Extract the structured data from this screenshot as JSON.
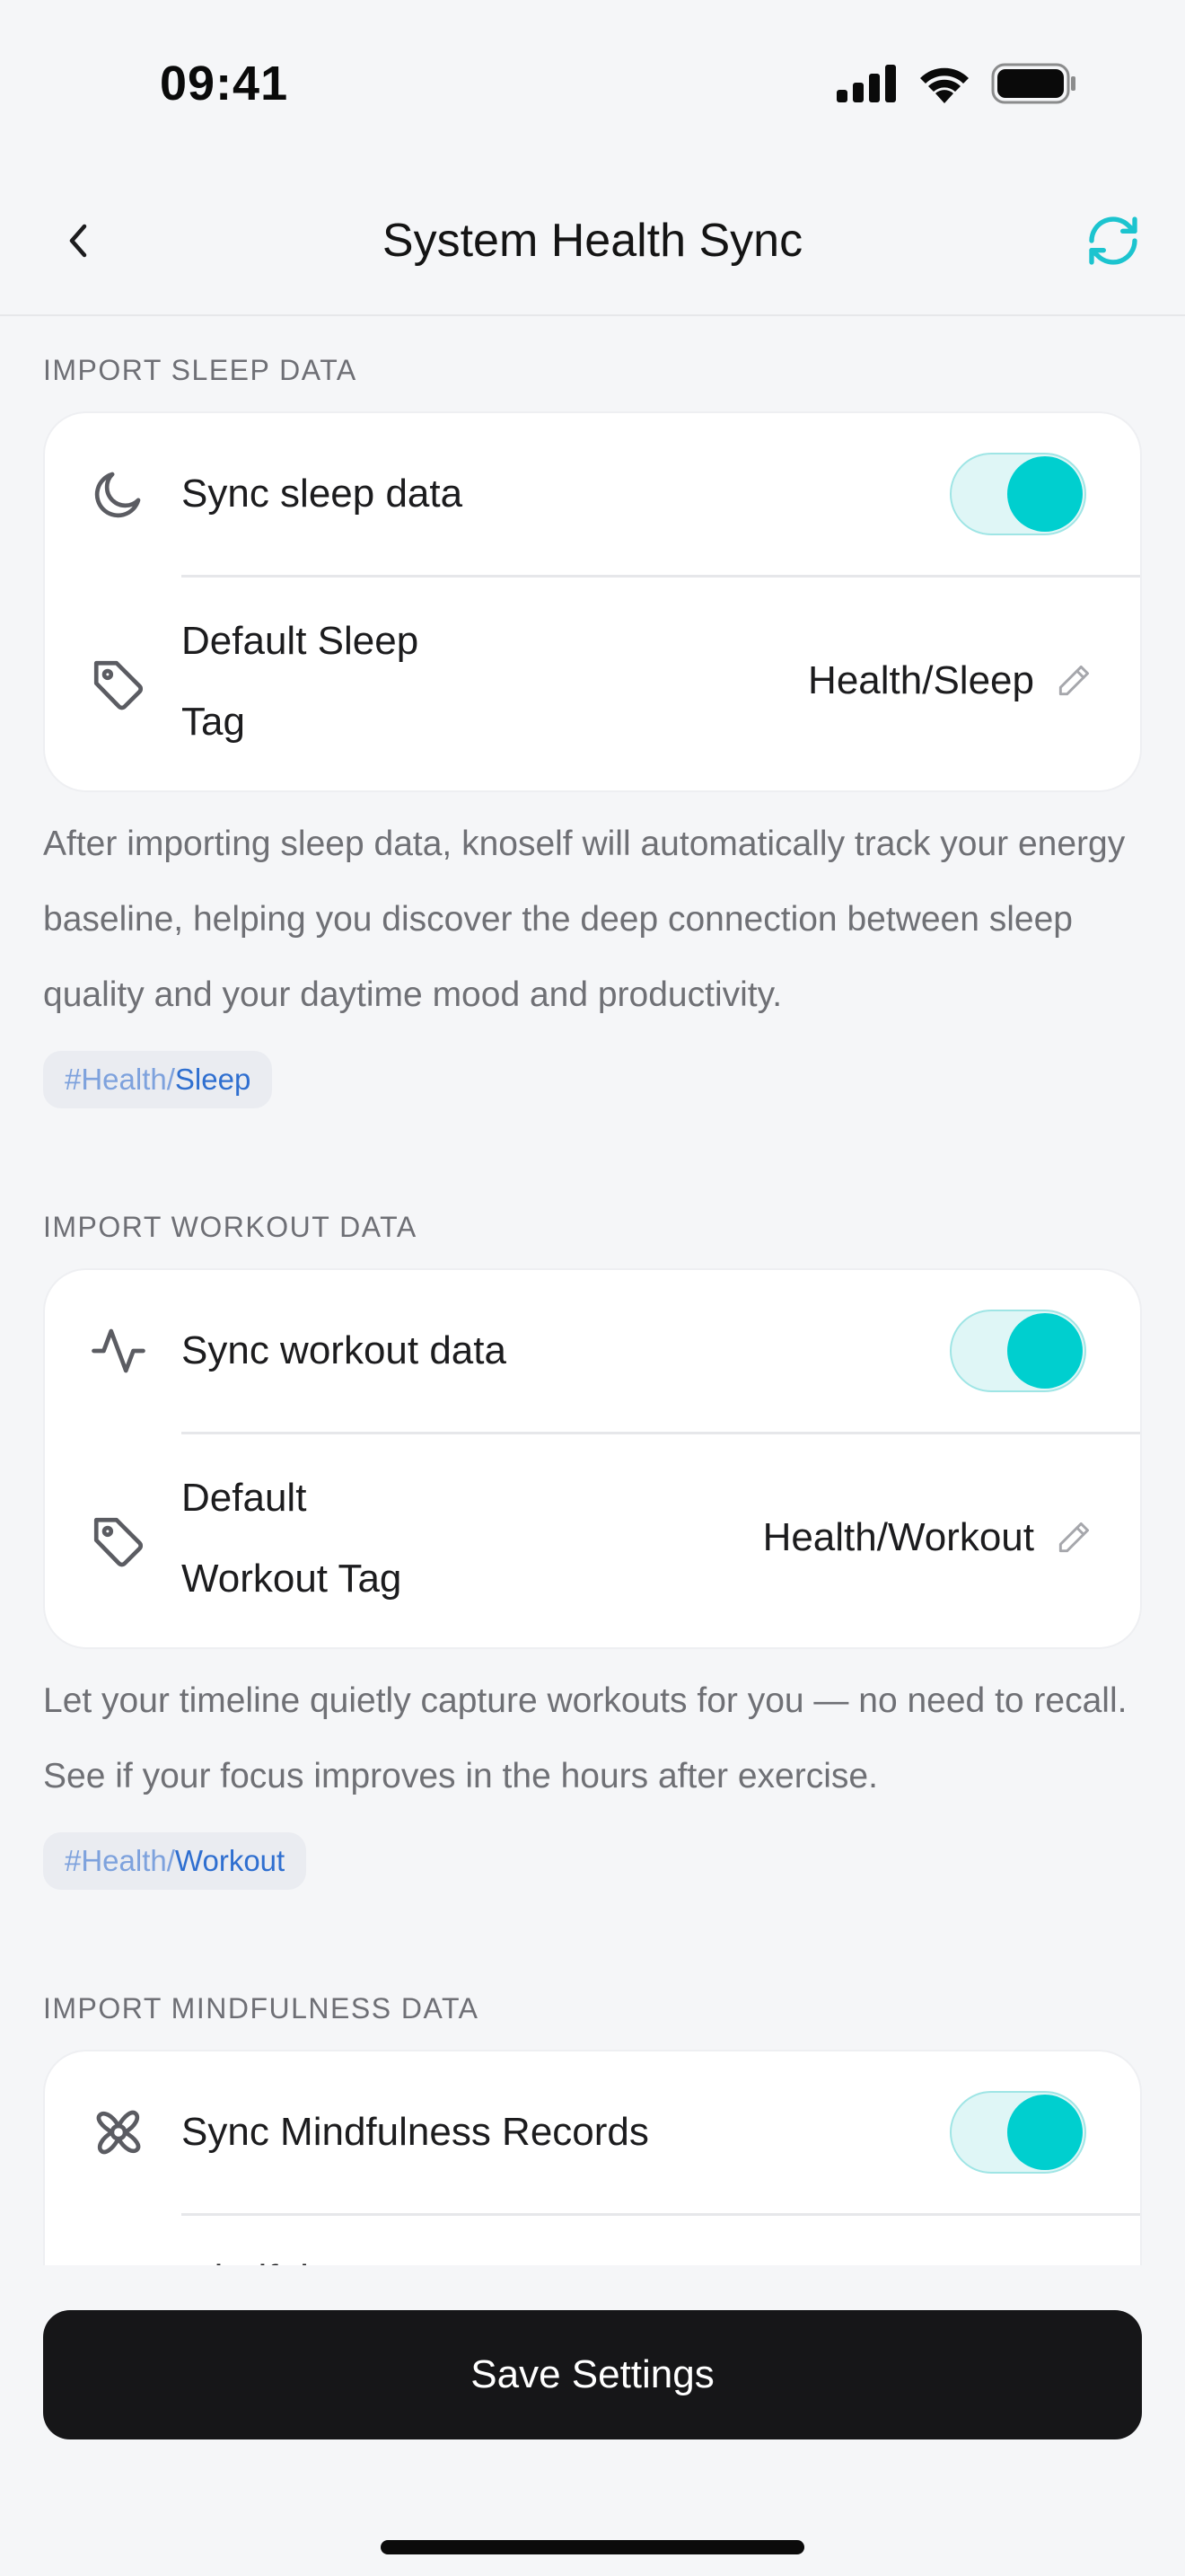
{
  "status_bar": {
    "time": "09:41"
  },
  "header": {
    "title": "System Health Sync"
  },
  "sleep": {
    "section_title": "IMPORT SLEEP DATA",
    "sync_label": "Sync sleep data",
    "sync_enabled": true,
    "tag_label_line1": "Default Sleep",
    "tag_label_line2": "Tag",
    "tag_value": "Health/Sleep",
    "description": "After importing sleep data, knoself will automatically track your energy baseline, helping you discover the deep connection between sleep quality and your daytime mood and productivity.",
    "chip_prefix": "#Health/",
    "chip_suffix": "Sleep"
  },
  "workout": {
    "section_title": "IMPORT WORKOUT DATA",
    "sync_label": "Sync workout data",
    "sync_enabled": true,
    "tag_label_line1": "Default",
    "tag_label_line2": "Workout Tag",
    "tag_value": "Health/Workout",
    "description": "Let your timeline quietly capture workouts for you — no need to recall. See if your focus improves in the hours after exercise.",
    "chip_prefix": "#Health/",
    "chip_suffix": "Workout"
  },
  "mindfulness": {
    "section_title": "IMPORT MINDFULNESS DATA",
    "sync_label": "Sync Mindfulness Records",
    "sync_enabled": true,
    "tag_label_partial": "Mindfulness"
  },
  "footer": {
    "save_label": "Save Settings"
  },
  "colors": {
    "accent": "#00cfcf",
    "primary_button": "#161618",
    "tag_link": "#2f6fd0"
  },
  "icons": {
    "back": "chevron-left-icon",
    "refresh": "refresh-icon",
    "sleep": "moon-icon",
    "tag": "tag-icon",
    "workout": "activity-icon",
    "mindfulness": "flower-icon",
    "edit": "pencil-icon"
  }
}
